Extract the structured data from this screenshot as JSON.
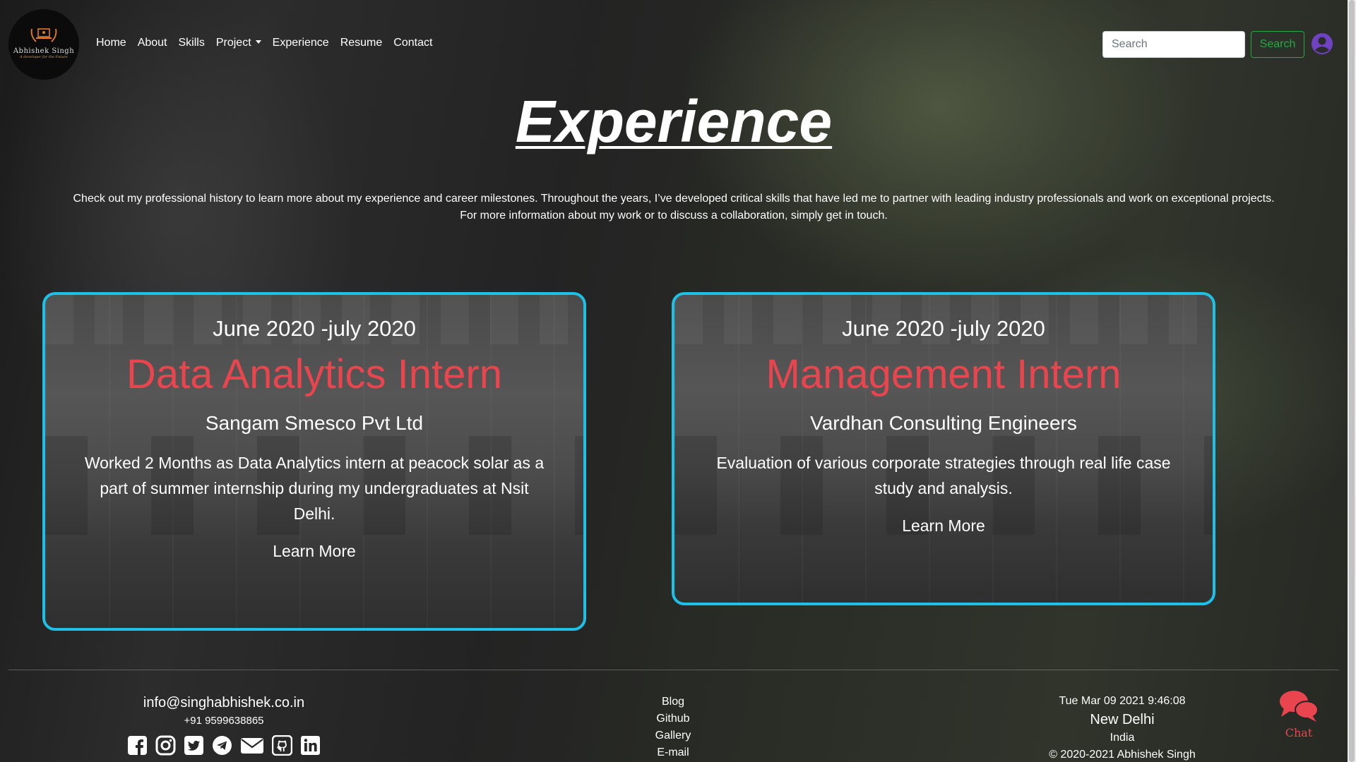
{
  "nav": {
    "logo_name": "Abhishek Singh",
    "logo_tagline": "A developer for the Future",
    "links": [
      "Home",
      "About",
      "Skills",
      "Project",
      "Experience",
      "Resume",
      "Contact"
    ],
    "search_placeholder": "Search",
    "search_button": "Search"
  },
  "page": {
    "title": "Experience",
    "intro_line1": "Check out my professional history to learn more about my experience and career milestones. Throughout the years, I’ve developed critical skills that have led me to partner with leading industry professionals and work on exceptional projects.",
    "intro_line2": "For more information about my work or to discuss a collaboration, simply get in touch."
  },
  "cards": [
    {
      "date": "June 2020 -july 2020",
      "role": "Data Analytics Intern",
      "company": "Sangam Smesco Pvt Ltd",
      "description": "Worked 2 Months as Data Analytics intern at peacock solar as a part of summer internship during my undergraduates at Nsit Delhi.",
      "link": "Learn More"
    },
    {
      "date": "June 2020 -july 2020",
      "role": "Management Intern",
      "company": "Vardhan Consulting Engineers",
      "description": "Evaluation of various corporate strategies through real life case study and analysis.",
      "link": "Learn More"
    }
  ],
  "footer": {
    "email": "info@singhabhishek.co.in",
    "phone": "+91 9599638865",
    "social_icons": [
      "facebook-icon",
      "instagram-icon",
      "twitter-icon",
      "telegram-icon",
      "mail-icon",
      "github-icon",
      "linkedin-icon"
    ],
    "links": [
      "Blog",
      "Github",
      "Gallery",
      "E-mail"
    ],
    "datetime": "Tue Mar 09 2021 9:46:08",
    "city": "New Delhi",
    "country": "India",
    "copyright": "© 2020-2021 Abhishek Singh",
    "chat_label": "Chat"
  },
  "colors": {
    "accent_red": "#e8454f",
    "card_border": "#1ec0e6",
    "search_green": "#28a745",
    "user_icon": "#6f42c1"
  }
}
